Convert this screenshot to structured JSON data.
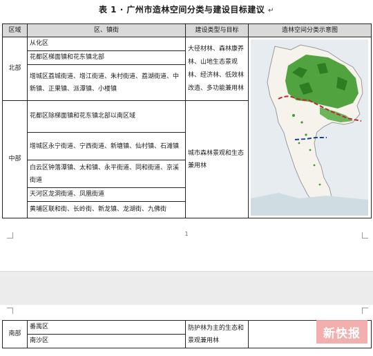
{
  "title": "表 1 · 广州市造林空间分类与建设目标建议",
  "headers": {
    "region": "区域",
    "district": "区、镇街",
    "type": "建设类型与目标",
    "map": "造林空间分类示意图"
  },
  "rows": {
    "north": {
      "region": "北部",
      "districts": [
        "从化区",
        "花都区梯面镇和花东镇北部",
        "增城区荔城街道、增江街道、朱村街道、荔湖街道、中新镇、正果镇、派潭镇、小楼镇"
      ],
      "type": "大径材林、森林康养林、山地生态景观林、经济林、低效林改造、多功能兼用林"
    },
    "central": {
      "region": "中部",
      "districts": [
        "花都区除梯面镇和花东镇北部以南区域",
        "增城区永宁街道、宁西街道、新塘镇、仙村镇、石滩镇",
        "白云区钟落潭镇、太和镇、永平街道、同和街道、京溪街道",
        "天河区龙洞街道、凤凰街道",
        "黄埔区联和街、长岭街、新龙镇、龙湖街、九佛街"
      ],
      "type": "城市森林景观和生态兼用林"
    },
    "south": {
      "region": "南部",
      "districts": [
        "番禺区",
        "南沙区"
      ],
      "type": "防护林为主的生态和景观兼用林"
    }
  },
  "page_number": "1",
  "watermark": "新快报",
  "colors": {
    "forest": "#3f9a2e",
    "boundary_red": "#c0262d",
    "boundary_blue": "#1d3f8f",
    "header_gray": "#d9d9d9"
  }
}
